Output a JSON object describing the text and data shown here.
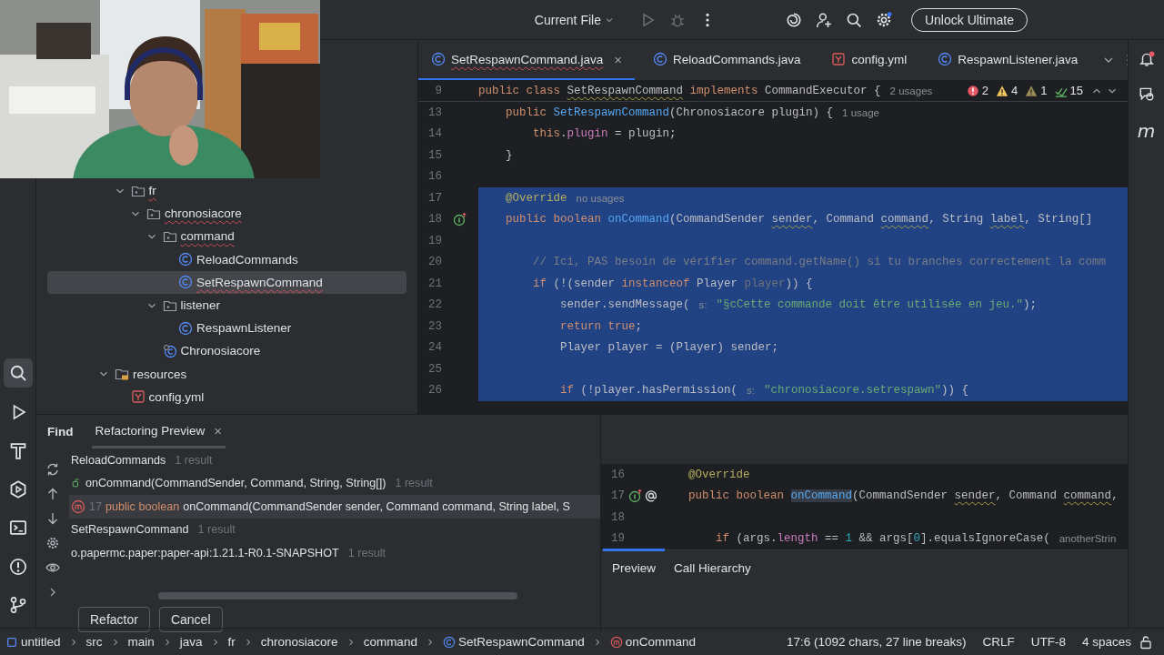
{
  "toolbar": {
    "run_config": "Current File",
    "upgrade_button": "Unlock Ultimate"
  },
  "left_stripe": [
    {
      "kind": "search",
      "selected": true
    },
    {
      "kind": "run",
      "selected": false
    },
    {
      "kind": "build",
      "selected": false
    },
    {
      "kind": "services",
      "selected": false
    },
    {
      "kind": "terminal",
      "selected": false
    },
    {
      "kind": "problems",
      "selected": false
    },
    {
      "kind": "git",
      "selected": false
    }
  ],
  "project_tree": [
    {
      "children": [
        {
          "label": "fr",
          "kind": "package",
          "expanded": true,
          "selected": false,
          "error": true,
          "children": [
            {
              "label": "chronosiacore",
              "kind": "package",
              "expanded": true,
              "selected": false,
              "error": true,
              "children": [
                {
                  "label": "command",
                  "kind": "package",
                  "expanded": true,
                  "selected": false,
                  "error": true,
                  "children": [
                    {
                      "label": "ReloadCommands",
                      "kind": "class",
                      "selected": false,
                      "error": false
                    },
                    {
                      "label": "SetRespawnCommand",
                      "kind": "class",
                      "selected": true,
                      "error": true
                    }
                  ]
                },
                {
                  "label": "listener",
                  "kind": "package",
                  "expanded": true,
                  "selected": false,
                  "error": false,
                  "children": [
                    {
                      "label": "RespawnListener",
                      "kind": "class",
                      "selected": false,
                      "error": false
                    }
                  ]
                },
                {
                  "label": "Chronosiacore",
                  "kind": "main-class",
                  "selected": false,
                  "error": false
                }
              ]
            }
          ]
        }
      ]
    },
    {
      "label": "resources",
      "kind": "resources",
      "expanded": true,
      "selected": false,
      "error": false,
      "children": [
        {
          "label": "config.yml",
          "kind": "yaml",
          "selected": false,
          "error": false
        }
      ]
    }
  ],
  "editor": {
    "tabs": [
      {
        "label": "SetRespawnCommand.java",
        "kind": "class",
        "selected": true,
        "error": true,
        "close": "×"
      },
      {
        "label": "ReloadCommands.java",
        "kind": "class",
        "selected": false,
        "error": false
      },
      {
        "label": "config.yml",
        "kind": "yaml",
        "selected": false,
        "error": false
      },
      {
        "label": "RespawnListener.java",
        "kind": "class",
        "selected": false,
        "error": false
      }
    ],
    "inspections": [
      {
        "kind": "error",
        "count": "2"
      },
      {
        "kind": "warning",
        "count": "4"
      },
      {
        "kind": "weak",
        "count": "1"
      },
      {
        "kind": "ok",
        "count": "15"
      }
    ],
    "sticky_line": {
      "number": "9",
      "tokens": [
        {
          "kind": "keyword",
          "text": "public class "
        },
        {
          "kind": "warn",
          "text": "SetRespawnCommand"
        },
        {
          "kind": "keyword",
          "text": " implements "
        },
        {
          "kind": "plain",
          "text": "CommandExecutor {"
        },
        {
          "kind": "hint",
          "text": "2 usages"
        }
      ]
    },
    "lines": [
      {
        "number": "13",
        "selected": false,
        "tokens": [
          {
            "kind": "keyword",
            "text": "    public "
          },
          {
            "kind": "decl",
            "text": "SetRespawnCommand"
          },
          {
            "kind": "plain",
            "text": "(Chronosiacore plugin) {"
          },
          {
            "kind": "hint",
            "text": "1 usage"
          }
        ]
      },
      {
        "number": "14",
        "selected": false,
        "tokens": [
          {
            "kind": "keyword",
            "text": "        this"
          },
          {
            "kind": "plain",
            "text": "."
          },
          {
            "kind": "field",
            "text": "plugin"
          },
          {
            "kind": "plain",
            "text": " = plugin;"
          }
        ]
      },
      {
        "number": "15",
        "selected": false,
        "tokens": [
          {
            "kind": "plain",
            "text": "    }"
          }
        ]
      },
      {
        "number": "16",
        "selected": false
      },
      {
        "number": "17",
        "selected": true,
        "tokens": [
          {
            "kind": "annotation",
            "text": "    @Override"
          },
          {
            "kind": "hint",
            "text": "no usages"
          }
        ]
      },
      {
        "number": "18",
        "selected": true,
        "gutter": {
          "kind": "override"
        },
        "tokens": [
          {
            "kind": "keyword",
            "text": "    public boolean "
          },
          {
            "kind": "decl",
            "text": "onCommand"
          },
          {
            "kind": "plain",
            "text": "(CommandSender "
          },
          {
            "kind": "warn",
            "text": "sender"
          },
          {
            "kind": "plain",
            "text": ", Command "
          },
          {
            "kind": "warn",
            "text": "command"
          },
          {
            "kind": "plain",
            "text": ", String "
          },
          {
            "kind": "warn",
            "text": "label"
          },
          {
            "kind": "plain",
            "text": ", String[]"
          }
        ]
      },
      {
        "number": "19",
        "selected": true
      },
      {
        "number": "20",
        "selected": true,
        "tokens": [
          {
            "kind": "comment",
            "text": "        // Ici, PAS besoin de vérifier command.getName() si tu branches correctement la comm"
          }
        ]
      },
      {
        "number": "21",
        "selected": true,
        "tokens": [
          {
            "kind": "keyword",
            "text": "        if "
          },
          {
            "kind": "plain",
            "text": "(!(sender "
          },
          {
            "kind": "keyword",
            "text": "instanceof "
          },
          {
            "kind": "plain",
            "text": "Player "
          },
          {
            "kind": "unused",
            "text": "player"
          },
          {
            "kind": "plain",
            "text": ")) {"
          }
        ]
      },
      {
        "number": "22",
        "selected": true,
        "tokens": [
          {
            "kind": "plain",
            "text": "            sender.sendMessage("
          },
          {
            "kind": "hint",
            "text": "s:"
          },
          {
            "kind": "string",
            "text": "\"§cCette commande doit être utilisée en jeu.\""
          },
          {
            "kind": "plain",
            "text": ");"
          }
        ]
      },
      {
        "number": "23",
        "selected": true,
        "tokens": [
          {
            "kind": "keyword",
            "text": "            return true"
          },
          {
            "kind": "plain",
            "text": ";"
          }
        ]
      },
      {
        "number": "24",
        "selected": true,
        "tokens": [
          {
            "kind": "plain",
            "text": "            Player player = (Player) sender;"
          }
        ]
      },
      {
        "number": "25",
        "selected": true
      },
      {
        "number": "26",
        "selected": true,
        "tokens": [
          {
            "kind": "keyword",
            "text": "            if "
          },
          {
            "kind": "plain",
            "text": "(!player.hasPermission("
          },
          {
            "kind": "hint",
            "text": "s:"
          },
          {
            "kind": "string",
            "text": "\"chronosiacore.setrespawn\""
          },
          {
            "kind": "plain",
            "text": ")) {"
          }
        ]
      }
    ]
  },
  "right_stripe": {
    "notifications_badge": true,
    "glyph": "m"
  },
  "find": {
    "title": "Find",
    "tabs": [
      {
        "label": "Refactoring Preview",
        "selected": true,
        "close": "×"
      }
    ],
    "results": [
      {
        "kind": "file",
        "text": "ReloadCommands",
        "count": "1 result",
        "selected": false
      },
      {
        "kind": "method",
        "text": "onCommand(CommandSender, Command, String, String[])",
        "count": "1 result",
        "selected": false
      },
      {
        "kind": "usage",
        "line": "17",
        "prefix": "public boolean",
        "text": "onCommand(CommandSender sender, Command command, String label, S",
        "selected": true
      },
      {
        "kind": "file",
        "text": "SetRespawnCommand",
        "count": "1 result",
        "selected": false
      },
      {
        "kind": "library",
        "text": "o.papermc.paper:paper-api:1.21.1-R0.1-SNAPSHOT",
        "count": "1 result",
        "selected": false
      }
    ],
    "buttons": [
      "Refactor",
      "Cancel"
    ]
  },
  "preview": {
    "lines": [
      {
        "number": "16",
        "tokens": [
          {
            "kind": "annotation",
            "text": "    @Override"
          }
        ]
      },
      {
        "number": "17",
        "gutter": {
          "kind": "override-usage"
        },
        "tokens": [
          {
            "kind": "keyword",
            "text": "    public boolean "
          },
          {
            "kind": "match",
            "text": "onCommand"
          },
          {
            "kind": "plain",
            "text": "(CommandSender "
          },
          {
            "kind": "warn",
            "text": "sender"
          },
          {
            "kind": "plain",
            "text": ", Command "
          },
          {
            "kind": "warn",
            "text": "command"
          },
          {
            "kind": "plain",
            "text": ","
          }
        ]
      },
      {
        "number": "18"
      },
      {
        "number": "19",
        "tokens": [
          {
            "kind": "keyword",
            "text": "        if "
          },
          {
            "kind": "plain",
            "text": "(args."
          },
          {
            "kind": "field",
            "text": "length"
          },
          {
            "kind": "plain",
            "text": " == "
          },
          {
            "kind": "number",
            "text": "1"
          },
          {
            "kind": "plain",
            "text": " && args["
          },
          {
            "kind": "number",
            "text": "0"
          },
          {
            "kind": "plain",
            "text": "].equalsIgnoreCase("
          },
          {
            "kind": "hint",
            "text": "anotherStrin"
          }
        ]
      }
    ],
    "tabs": [
      {
        "label": "Preview",
        "selected": true
      },
      {
        "label": "Call Hierarchy",
        "selected": false
      }
    ]
  },
  "status_bar": {
    "breadcrumbs": [
      {
        "label": "untitled",
        "kind": "module"
      },
      {
        "label": "src",
        "kind": "folder"
      },
      {
        "label": "main",
        "kind": "folder"
      },
      {
        "label": "java",
        "kind": "folder"
      },
      {
        "label": "fr",
        "kind": "folder"
      },
      {
        "label": "chronosiacore",
        "kind": "folder"
      },
      {
        "label": "command",
        "kind": "folder"
      },
      {
        "label": "SetRespawnCommand",
        "kind": "class"
      },
      {
        "label": "onCommand",
        "kind": "method"
      }
    ],
    "position": "17:6 (1092 chars, 27 line breaks)",
    "line_separator": "CRLF",
    "encoding": "UTF-8",
    "indent": "4 spaces",
    "read_only_lock": false
  }
}
